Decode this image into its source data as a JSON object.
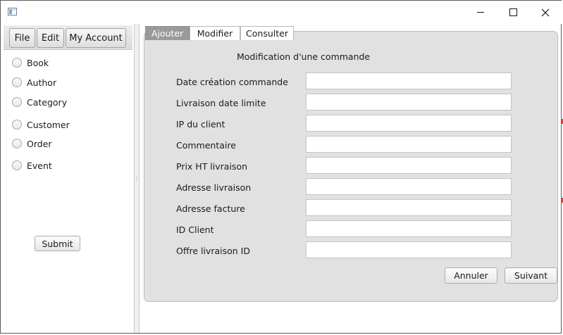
{
  "menubar": {
    "items": [
      {
        "label": "File"
      },
      {
        "label": "Edit"
      },
      {
        "label": "My Account"
      }
    ]
  },
  "sidebar": {
    "options": [
      {
        "label": "Book"
      },
      {
        "label": "Author"
      },
      {
        "label": "Category"
      },
      {
        "label": "Customer"
      },
      {
        "label": "Order"
      },
      {
        "label": "Event"
      }
    ],
    "submit_label": "Submit"
  },
  "tabs": [
    {
      "label": "Ajouter",
      "active": true
    },
    {
      "label": "Modifier",
      "active": false
    },
    {
      "label": "Consulter",
      "active": false
    }
  ],
  "form": {
    "title": "Modification d'une commande",
    "fields": [
      {
        "label": "Date création commande",
        "value": ""
      },
      {
        "label": "Livraison date limite",
        "value": ""
      },
      {
        "label": "IP du client",
        "value": ""
      },
      {
        "label": "Commentaire",
        "value": ""
      },
      {
        "label": "Prix HT livraison",
        "value": ""
      },
      {
        "label": "Adresse livraison",
        "value": ""
      },
      {
        "label": "Adresse facture",
        "value": ""
      },
      {
        "label": "ID Client",
        "value": ""
      },
      {
        "label": "Offre livraison ID",
        "value": ""
      }
    ],
    "cancel_label": "Annuler",
    "next_label": "Suivant"
  },
  "colors": {
    "panel_background": "#e1e1e1",
    "active_tab": "#9a9a9a",
    "edge_marker": "#d23b3b"
  }
}
